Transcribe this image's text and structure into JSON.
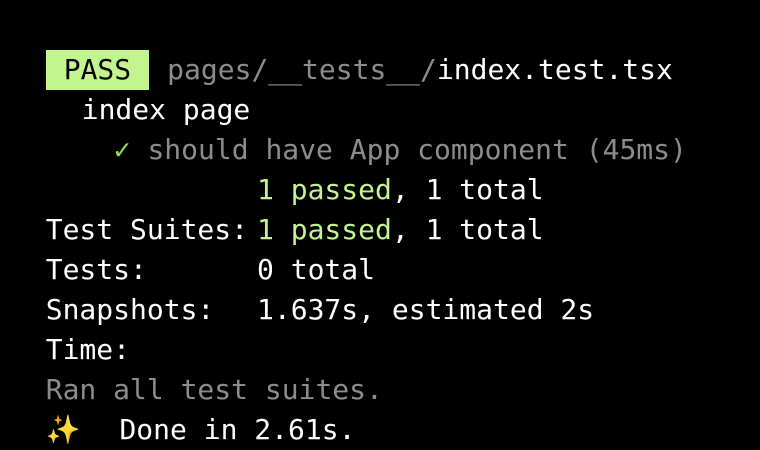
{
  "header": {
    "badge": "PASS",
    "path_dim": "pages/__tests__/",
    "path_file": "index.test.tsx"
  },
  "suite": {
    "describe": "index page",
    "check_mark": "✓",
    "test_name": "should have App component (45ms)"
  },
  "summary": {
    "suites_label": "Test Suites:",
    "suites_passed": "1 passed",
    "suites_total": ", 1 total",
    "tests_label": "Tests:",
    "tests_passed": "1 passed",
    "tests_total": ", 1 total",
    "snapshots_label": "Snapshots:",
    "snapshots_value": "0 total",
    "time_label": "Time:",
    "time_value": "1.637s, estimated 2s"
  },
  "footer": {
    "ran_all": "Ran all test suites.",
    "sparkles": "✨",
    "done": "Done in 2.61s."
  },
  "colors": {
    "background": "#000000",
    "pass_badge": "#c3f58f",
    "passed_text": "#c3f58f",
    "check_mark": "#8fe05a",
    "dim_text": "#8c8c8c",
    "normal_text": "#ffffff"
  }
}
